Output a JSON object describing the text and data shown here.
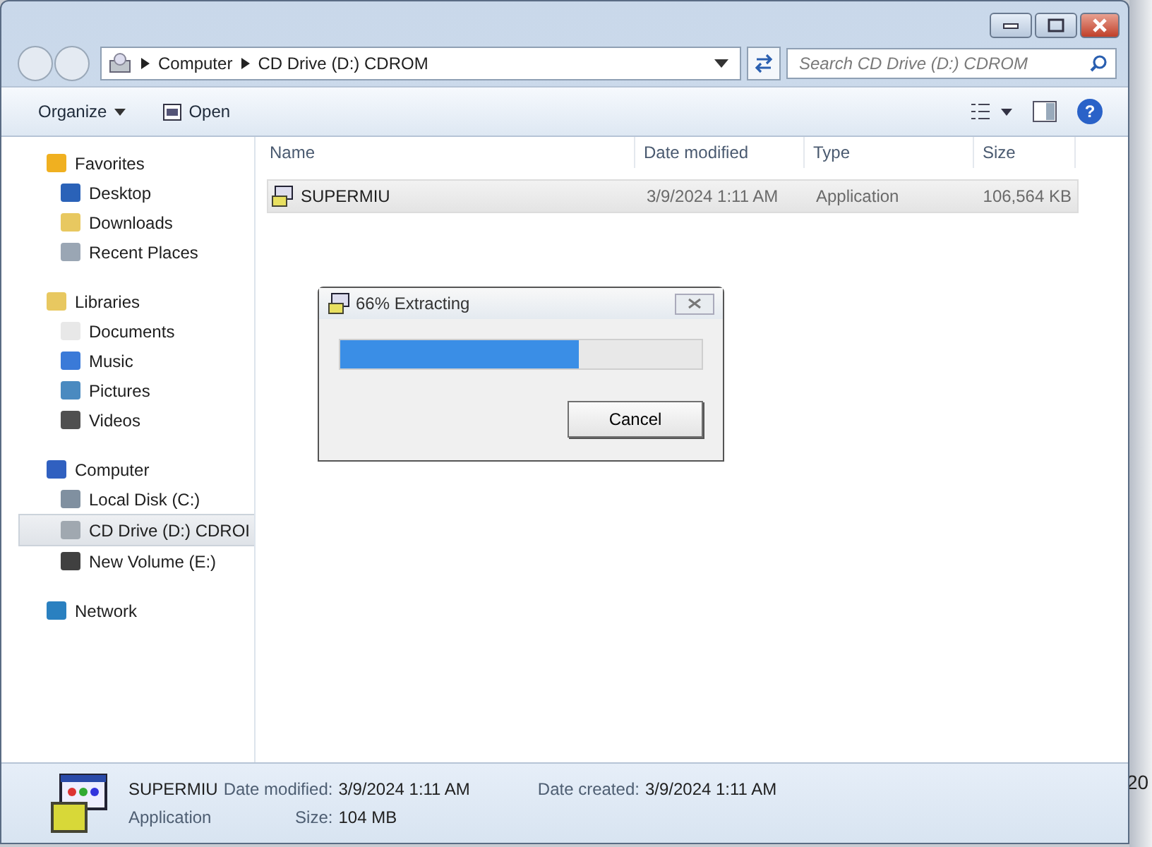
{
  "address": {
    "crumbs": [
      "Computer",
      "CD Drive (D:) CDROM"
    ]
  },
  "search": {
    "placeholder": "Search CD Drive (D:) CDROM"
  },
  "toolbar": {
    "organize": "Organize",
    "open": "Open",
    "help": "?"
  },
  "sidebar": {
    "groups": [
      {
        "label": "Favorites",
        "kind": "star",
        "children": [
          {
            "label": "Desktop",
            "kind": "desktop",
            "selected": false
          },
          {
            "label": "Downloads",
            "kind": "folder",
            "selected": false
          },
          {
            "label": "Recent Places",
            "kind": "recent",
            "selected": false
          }
        ]
      },
      {
        "label": "Libraries",
        "kind": "folder",
        "children": [
          {
            "label": "Documents",
            "kind": "doc",
            "selected": false
          },
          {
            "label": "Music",
            "kind": "music",
            "selected": false
          },
          {
            "label": "Pictures",
            "kind": "picture",
            "selected": false
          },
          {
            "label": "Videos",
            "kind": "video",
            "selected": false
          }
        ]
      },
      {
        "label": "Computer",
        "kind": "computer",
        "children": [
          {
            "label": "Local Disk (C:)",
            "kind": "disk",
            "selected": false
          },
          {
            "label": "CD Drive (D:) CDROI",
            "kind": "cd",
            "selected": true
          },
          {
            "label": "New Volume (E:)",
            "kind": "drive",
            "selected": false
          }
        ]
      },
      {
        "label": "Network",
        "kind": "network"
      }
    ]
  },
  "table": {
    "columns": [
      "Name",
      "Date modified",
      "Type",
      "Size"
    ],
    "rows": [
      {
        "name": "SUPERMIU",
        "date": "3/9/2024 1:11 AM",
        "type": "Application",
        "size": "106,564 KB",
        "selected": true
      }
    ]
  },
  "dialog": {
    "title": "66% Extracting",
    "level": 0.66,
    "button": "Cancel"
  },
  "details": {
    "name": "SUPERMIU",
    "type": "Application",
    "fields": [
      {
        "label": "Date modified:",
        "value": "3/9/2024 1:11 AM"
      },
      {
        "label": "Date created:",
        "value": "3/9/2024 1:11 AM"
      },
      {
        "label": "Size:",
        "value": "104 MB"
      }
    ]
  },
  "desktop_text": "20"
}
